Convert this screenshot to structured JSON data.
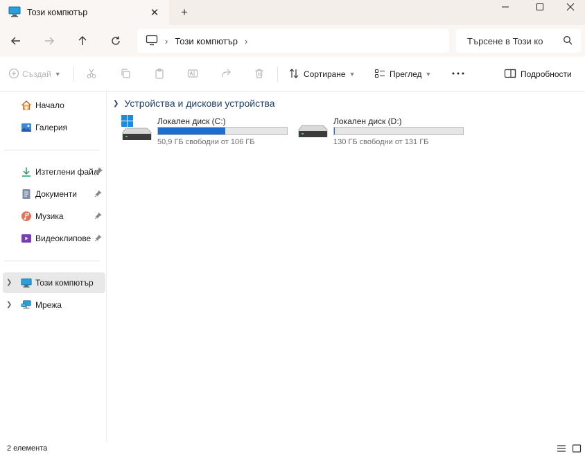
{
  "window": {
    "tab_title": "Този компютър",
    "tab_icon": "this-pc-icon"
  },
  "address": {
    "location": "Този компютър",
    "search_placeholder": "Търсене в Този ко"
  },
  "command_bar": {
    "new_label": "Създай",
    "sort_label": "Сортиране",
    "view_label": "Преглед",
    "details_label": "Подробности"
  },
  "sidebar": {
    "quick": [
      {
        "label": "Начало",
        "icon": "home-icon"
      },
      {
        "label": "Галерия",
        "icon": "gallery-icon"
      }
    ],
    "pinned": [
      {
        "label": "Изтеглени файлове",
        "icon": "downloads-icon"
      },
      {
        "label": "Документи",
        "icon": "documents-icon"
      },
      {
        "label": "Музика",
        "icon": "music-icon"
      },
      {
        "label": "Видеоклипове",
        "icon": "videos-icon"
      }
    ],
    "locations": [
      {
        "label": "Този компютър",
        "icon": "this-pc-icon",
        "selected": true
      },
      {
        "label": "Мрежа",
        "icon": "network-icon"
      }
    ]
  },
  "main": {
    "group_title": "Устройства и дискови устройства",
    "drives": [
      {
        "name": "Локален диск (C:)",
        "free_text": "50,9 ГБ свободни от 106 ГБ",
        "used_fraction": 0.52,
        "system": true
      },
      {
        "name": "Локален диск (D:)",
        "free_text": "130 ГБ свободни от 131 ГБ",
        "used_fraction": 0.008,
        "system": false
      }
    ]
  },
  "status": {
    "item_count": "2 елемента"
  },
  "colors": {
    "accent": "#1c6fce",
    "group_header": "#1c3e6e",
    "titlebar": "#f3eeea"
  }
}
